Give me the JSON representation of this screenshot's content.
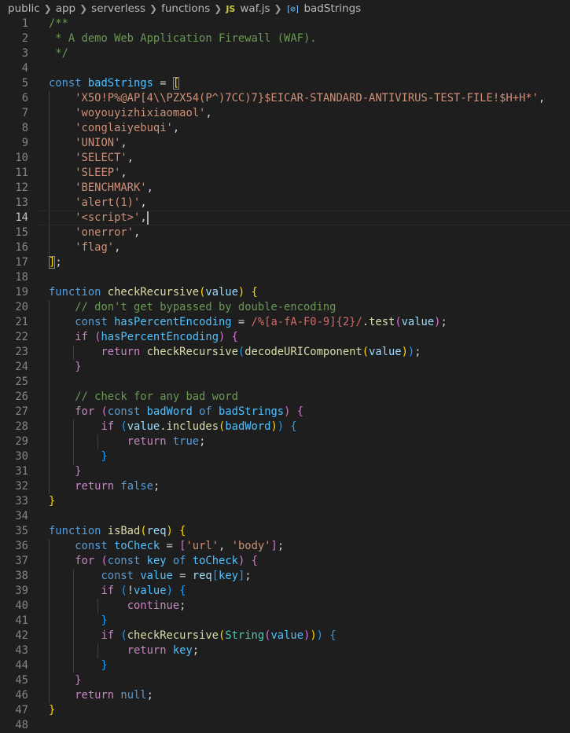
{
  "breadcrumb": {
    "items": [
      "public",
      "app",
      "serverless",
      "functions",
      "waf.js",
      "badStrings"
    ],
    "file_icon": "JS",
    "symbol_icon": "[⊘]"
  },
  "theme": {
    "background": "#1e1e1e",
    "line_number": "#858585",
    "default": "#d4d4d4",
    "keyword": "#569cd6",
    "control": "#c586c0",
    "variable": "#9cdcfe",
    "function": "#dcdcaa",
    "string": "#ce9178",
    "comment": "#6a9955",
    "regex": "#d16969",
    "class": "#4ec9b0",
    "constant": "#4fc1ff",
    "bracket_1": "#ffd700",
    "bracket_2": "#da70d6",
    "bracket_3": "#179fff"
  },
  "editor": {
    "cursor_line": 14,
    "lines": [
      [
        [
          "/**",
          "comment"
        ]
      ],
      [
        [
          " * A demo Web Application Firewall (WAF).",
          "comment"
        ]
      ],
      [
        [
          " */",
          "comment"
        ]
      ],
      [],
      [
        [
          "const",
          "keyword"
        ],
        [
          " ",
          "default"
        ],
        [
          "badStrings",
          "constant"
        ],
        [
          " = ",
          "default"
        ],
        [
          "[",
          "bracket_1",
          "bracket-match"
        ]
      ],
      [
        [
          "    ",
          "default"
        ],
        [
          "'X5O!P%@AP[4\\\\PZX54(P^)7CC)7}$EICAR-STANDARD-ANTIVIRUS-TEST-FILE!$H+H*'",
          "string"
        ],
        [
          ",",
          "default"
        ]
      ],
      [
        [
          "    ",
          "default"
        ],
        [
          "'woyouyizhixiaomaol'",
          "string"
        ],
        [
          ",",
          "default"
        ]
      ],
      [
        [
          "    ",
          "default"
        ],
        [
          "'conglaiyebuqi'",
          "string"
        ],
        [
          ",",
          "default"
        ]
      ],
      [
        [
          "    ",
          "default"
        ],
        [
          "'UNION'",
          "string"
        ],
        [
          ",",
          "default"
        ]
      ],
      [
        [
          "    ",
          "default"
        ],
        [
          "'SELECT'",
          "string"
        ],
        [
          ",",
          "default"
        ]
      ],
      [
        [
          "    ",
          "default"
        ],
        [
          "'SLEEP'",
          "string"
        ],
        [
          ",",
          "default"
        ]
      ],
      [
        [
          "    ",
          "default"
        ],
        [
          "'BENCHMARK'",
          "string"
        ],
        [
          ",",
          "default"
        ]
      ],
      [
        [
          "    ",
          "default"
        ],
        [
          "'alert(1)'",
          "string"
        ],
        [
          ",",
          "default"
        ]
      ],
      [
        [
          "    ",
          "default"
        ],
        [
          "'<script>'",
          "string"
        ],
        [
          ",",
          "default"
        ]
      ],
      [
        [
          "    ",
          "default"
        ],
        [
          "'onerror'",
          "string"
        ],
        [
          ",",
          "default"
        ]
      ],
      [
        [
          "    ",
          "default"
        ],
        [
          "'flag'",
          "string"
        ],
        [
          ",",
          "default"
        ]
      ],
      [
        [
          "]",
          "bracket_1",
          "bracket-match"
        ],
        [
          ";",
          "default"
        ]
      ],
      [],
      [
        [
          "function",
          "keyword"
        ],
        [
          " ",
          "default"
        ],
        [
          "checkRecursive",
          "function"
        ],
        [
          "(",
          "bracket_1"
        ],
        [
          "value",
          "variable"
        ],
        [
          ")",
          "bracket_1"
        ],
        [
          " ",
          "default"
        ],
        [
          "{",
          "bracket_1"
        ]
      ],
      [
        [
          "    ",
          "default"
        ],
        [
          "// don't get bypassed by double-encoding",
          "comment"
        ]
      ],
      [
        [
          "    ",
          "default"
        ],
        [
          "const",
          "keyword"
        ],
        [
          " ",
          "default"
        ],
        [
          "hasPercentEncoding",
          "constant"
        ],
        [
          " = ",
          "default"
        ],
        [
          "/%[a-fA-F0-9]{2}/",
          "regex"
        ],
        [
          ".",
          "default"
        ],
        [
          "test",
          "function"
        ],
        [
          "(",
          "bracket_2"
        ],
        [
          "value",
          "variable"
        ],
        [
          ")",
          "bracket_2"
        ],
        [
          ";",
          "default"
        ]
      ],
      [
        [
          "    ",
          "default"
        ],
        [
          "if",
          "control"
        ],
        [
          " ",
          "default"
        ],
        [
          "(",
          "bracket_2"
        ],
        [
          "hasPercentEncoding",
          "constant"
        ],
        [
          ")",
          "bracket_2"
        ],
        [
          " ",
          "default"
        ],
        [
          "{",
          "bracket_2"
        ]
      ],
      [
        [
          "        ",
          "default"
        ],
        [
          "return",
          "control"
        ],
        [
          " ",
          "default"
        ],
        [
          "checkRecursive",
          "function"
        ],
        [
          "(",
          "bracket_3"
        ],
        [
          "decodeURIComponent",
          "function"
        ],
        [
          "(",
          "bracket_1"
        ],
        [
          "value",
          "variable"
        ],
        [
          ")",
          "bracket_1"
        ],
        [
          ")",
          "bracket_3"
        ],
        [
          ";",
          "default"
        ]
      ],
      [
        [
          "    ",
          "default"
        ],
        [
          "}",
          "bracket_2"
        ]
      ],
      [],
      [
        [
          "    ",
          "default"
        ],
        [
          "// check for any bad word",
          "comment"
        ]
      ],
      [
        [
          "    ",
          "default"
        ],
        [
          "for",
          "control"
        ],
        [
          " ",
          "default"
        ],
        [
          "(",
          "bracket_2"
        ],
        [
          "const",
          "keyword"
        ],
        [
          " ",
          "default"
        ],
        [
          "badWord",
          "constant"
        ],
        [
          " ",
          "default"
        ],
        [
          "of",
          "keyword"
        ],
        [
          " ",
          "default"
        ],
        [
          "badStrings",
          "constant"
        ],
        [
          ")",
          "bracket_2"
        ],
        [
          " ",
          "default"
        ],
        [
          "{",
          "bracket_2"
        ]
      ],
      [
        [
          "        ",
          "default"
        ],
        [
          "if",
          "control"
        ],
        [
          " ",
          "default"
        ],
        [
          "(",
          "bracket_3"
        ],
        [
          "value",
          "variable"
        ],
        [
          ".",
          "default"
        ],
        [
          "includes",
          "function"
        ],
        [
          "(",
          "bracket_1"
        ],
        [
          "badWord",
          "constant"
        ],
        [
          ")",
          "bracket_1"
        ],
        [
          ")",
          "bracket_3"
        ],
        [
          " ",
          "default"
        ],
        [
          "{",
          "bracket_3"
        ]
      ],
      [
        [
          "            ",
          "default"
        ],
        [
          "return",
          "control"
        ],
        [
          " ",
          "default"
        ],
        [
          "true",
          "keyword"
        ],
        [
          ";",
          "default"
        ]
      ],
      [
        [
          "        ",
          "default"
        ],
        [
          "}",
          "bracket_3"
        ]
      ],
      [
        [
          "    ",
          "default"
        ],
        [
          "}",
          "bracket_2"
        ]
      ],
      [
        [
          "    ",
          "default"
        ],
        [
          "return",
          "control"
        ],
        [
          " ",
          "default"
        ],
        [
          "false",
          "keyword"
        ],
        [
          ";",
          "default"
        ]
      ],
      [
        [
          "}",
          "bracket_1"
        ]
      ],
      [],
      [
        [
          "function",
          "keyword"
        ],
        [
          " ",
          "default"
        ],
        [
          "isBad",
          "function"
        ],
        [
          "(",
          "bracket_1"
        ],
        [
          "req",
          "variable"
        ],
        [
          ")",
          "bracket_1"
        ],
        [
          " ",
          "default"
        ],
        [
          "{",
          "bracket_1"
        ]
      ],
      [
        [
          "    ",
          "default"
        ],
        [
          "const",
          "keyword"
        ],
        [
          " ",
          "default"
        ],
        [
          "toCheck",
          "constant"
        ],
        [
          " = ",
          "default"
        ],
        [
          "[",
          "bracket_2"
        ],
        [
          "'url'",
          "string"
        ],
        [
          ", ",
          "default"
        ],
        [
          "'body'",
          "string"
        ],
        [
          "]",
          "bracket_2"
        ],
        [
          ";",
          "default"
        ]
      ],
      [
        [
          "    ",
          "default"
        ],
        [
          "for",
          "control"
        ],
        [
          " ",
          "default"
        ],
        [
          "(",
          "bracket_2"
        ],
        [
          "const",
          "keyword"
        ],
        [
          " ",
          "default"
        ],
        [
          "key",
          "constant"
        ],
        [
          " ",
          "default"
        ],
        [
          "of",
          "keyword"
        ],
        [
          " ",
          "default"
        ],
        [
          "toCheck",
          "constant"
        ],
        [
          ")",
          "bracket_2"
        ],
        [
          " ",
          "default"
        ],
        [
          "{",
          "bracket_2"
        ]
      ],
      [
        [
          "        ",
          "default"
        ],
        [
          "const",
          "keyword"
        ],
        [
          " ",
          "default"
        ],
        [
          "value",
          "constant"
        ],
        [
          " = ",
          "default"
        ],
        [
          "req",
          "variable"
        ],
        [
          "[",
          "bracket_3"
        ],
        [
          "key",
          "constant"
        ],
        [
          "]",
          "bracket_3"
        ],
        [
          ";",
          "default"
        ]
      ],
      [
        [
          "        ",
          "default"
        ],
        [
          "if",
          "control"
        ],
        [
          " ",
          "default"
        ],
        [
          "(",
          "bracket_3"
        ],
        [
          "!",
          "default"
        ],
        [
          "value",
          "constant"
        ],
        [
          ")",
          "bracket_3"
        ],
        [
          " ",
          "default"
        ],
        [
          "{",
          "bracket_3"
        ]
      ],
      [
        [
          "            ",
          "default"
        ],
        [
          "continue",
          "control"
        ],
        [
          ";",
          "default"
        ]
      ],
      [
        [
          "        ",
          "default"
        ],
        [
          "}",
          "bracket_3"
        ]
      ],
      [
        [
          "        ",
          "default"
        ],
        [
          "if",
          "control"
        ],
        [
          " ",
          "default"
        ],
        [
          "(",
          "bracket_3"
        ],
        [
          "checkRecursive",
          "function"
        ],
        [
          "(",
          "bracket_1"
        ],
        [
          "String",
          "class"
        ],
        [
          "(",
          "bracket_2"
        ],
        [
          "value",
          "constant"
        ],
        [
          ")",
          "bracket_2"
        ],
        [
          ")",
          "bracket_1"
        ],
        [
          ")",
          "bracket_3"
        ],
        [
          " ",
          "default"
        ],
        [
          "{",
          "bracket_3"
        ]
      ],
      [
        [
          "            ",
          "default"
        ],
        [
          "return",
          "control"
        ],
        [
          " ",
          "default"
        ],
        [
          "key",
          "constant"
        ],
        [
          ";",
          "default"
        ]
      ],
      [
        [
          "        ",
          "default"
        ],
        [
          "}",
          "bracket_3"
        ]
      ],
      [
        [
          "    ",
          "default"
        ],
        [
          "}",
          "bracket_2"
        ]
      ],
      [
        [
          "    ",
          "default"
        ],
        [
          "return",
          "control"
        ],
        [
          " ",
          "default"
        ],
        [
          "null",
          "keyword"
        ],
        [
          ";",
          "default"
        ]
      ],
      [
        [
          "}",
          "bracket_1"
        ]
      ],
      []
    ]
  }
}
